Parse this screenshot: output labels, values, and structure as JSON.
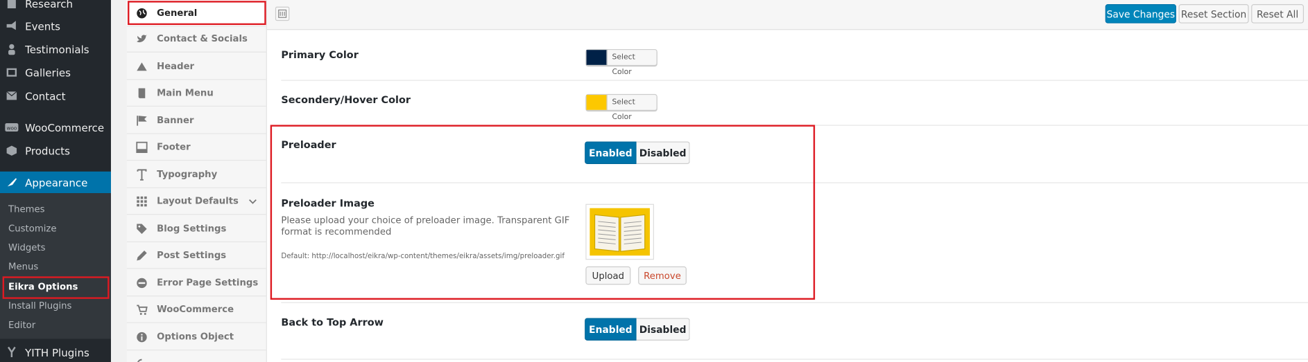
{
  "admin_menu": {
    "items": [
      {
        "label": "Research",
        "icon": "document-icon"
      },
      {
        "label": "Events",
        "icon": "megaphone-icon"
      },
      {
        "label": "Testimonials",
        "icon": "person-icon"
      },
      {
        "label": "Galleries",
        "icon": "gallery-icon"
      },
      {
        "label": "Contact",
        "icon": "envelope-icon"
      },
      {
        "label": "WooCommerce",
        "icon": "woocommerce-icon"
      },
      {
        "label": "Products",
        "icon": "box-icon"
      },
      {
        "label": "Appearance",
        "icon": "brush-icon"
      },
      {
        "label": "YITH Plugins",
        "icon": "yith-icon"
      }
    ],
    "submenu": [
      "Themes",
      "Customize",
      "Widgets",
      "Menus",
      "Eikra Options",
      "Install Plugins",
      "Editor"
    ]
  },
  "options_nav": {
    "items": [
      {
        "label": "General",
        "icon": "globe-icon"
      },
      {
        "label": "Contact & Socials",
        "icon": "twitter-icon"
      },
      {
        "label": "Header",
        "icon": "triangle-icon"
      },
      {
        "label": "Main Menu",
        "icon": "book-icon"
      },
      {
        "label": "Banner",
        "icon": "flag-icon"
      },
      {
        "label": "Footer",
        "icon": "footer-icon"
      },
      {
        "label": "Typography",
        "icon": "text-icon"
      },
      {
        "label": "Layout Defaults",
        "icon": "grid-icon"
      },
      {
        "label": "Blog Settings",
        "icon": "tag-icon"
      },
      {
        "label": "Post Settings",
        "icon": "pencil-icon"
      },
      {
        "label": "Error Page Settings",
        "icon": "minus-circle-icon"
      },
      {
        "label": "WooCommerce",
        "icon": "cart-icon"
      },
      {
        "label": "Options Object",
        "icon": "info-icon"
      }
    ]
  },
  "toolbar": {
    "save_label": "Save Changes",
    "reset_section_label": "Reset Section",
    "reset_all_label": "Reset All"
  },
  "fields": {
    "primary_color": {
      "label": "Primary Color",
      "button": "Select Color",
      "color": "#002147"
    },
    "secondary_color": {
      "label": "Secondery/Hover Color",
      "button": "Select Color",
      "color": "#fdc800"
    },
    "preloader": {
      "label": "Preloader",
      "enabled": "Enabled",
      "disabled": "Disabled",
      "value": "Enabled"
    },
    "preloader_image": {
      "label": "Preloader Image",
      "description": "Please upload your choice of preloader image. Transparent GIF format is recommended",
      "default": "Default: http://localhost/eikra/wp-content/themes/eikra/assets/img/preloader.gif",
      "upload": "Upload",
      "remove": "Remove"
    },
    "back_to_top": {
      "label": "Back to Top Arrow",
      "enabled": "Enabled",
      "disabled": "Disabled",
      "value": "Enabled"
    }
  }
}
